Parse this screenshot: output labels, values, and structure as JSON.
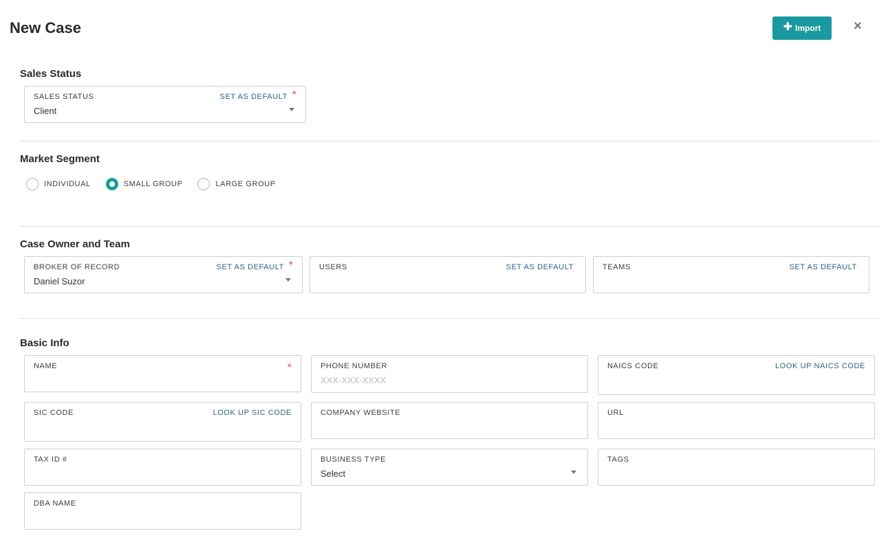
{
  "header": {
    "title": "New Case",
    "import_label": "Import",
    "close_glyph": "×",
    "accent_color": "#1a9aa0"
  },
  "sales_status": {
    "section_title": "Sales Status",
    "field_label": "SALES STATUS",
    "set_default": "SET AS DEFAULT",
    "value": "Client"
  },
  "market_segment": {
    "section_title": "Market Segment",
    "options": [
      {
        "label": "INDIVIDUAL",
        "selected": false
      },
      {
        "label": "SMALL GROUP",
        "selected": true
      },
      {
        "label": "LARGE GROUP",
        "selected": false
      }
    ]
  },
  "case_owner": {
    "section_title": "Case Owner and Team",
    "broker": {
      "label": "BROKER OF RECORD",
      "set_default": "SET AS DEFAULT",
      "value": "Daniel Suzor"
    },
    "users": {
      "label": "USERS",
      "set_default": "SET AS DEFAULT"
    },
    "teams": {
      "label": "TEAMS",
      "set_default": "SET AS DEFAULT"
    }
  },
  "basic_info": {
    "section_title": "Basic Info",
    "name": {
      "label": "NAME"
    },
    "phone": {
      "label": "PHONE NUMBER",
      "placeholder": "XXX-XXX-XXXX"
    },
    "naics": {
      "label": "NAICS CODE",
      "action": "LOOK UP NAICS CODE"
    },
    "sic": {
      "label": "SIC CODE",
      "action": "LOOK UP SIC CODE"
    },
    "website": {
      "label": "COMPANY WEBSITE"
    },
    "url": {
      "label": "URL"
    },
    "tax_id": {
      "label": "TAX ID #"
    },
    "business_type": {
      "label": "BUSINESS TYPE",
      "value": "Select"
    },
    "tags": {
      "label": "TAGS"
    },
    "dba": {
      "label": "DBA NAME"
    }
  },
  "required_mark": "*"
}
